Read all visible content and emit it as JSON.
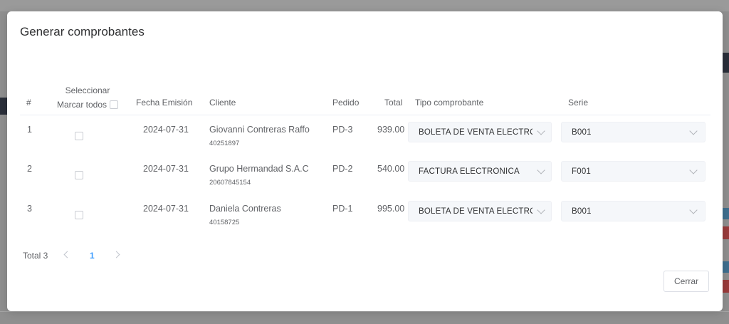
{
  "dialog": {
    "title": "Generar comprobantes"
  },
  "table": {
    "headers": {
      "index": "#",
      "select_line1": "Seleccionar",
      "select_line2": "Marcar todos",
      "fecha": "Fecha Emisión",
      "cliente": "Cliente",
      "pedido": "Pedido",
      "total": "Total",
      "tipo": "Tipo comprobante",
      "serie": "Serie"
    },
    "rows": [
      {
        "index": "1",
        "fecha": "2024-07-31",
        "cliente": "Giovanni Contreras Raffo",
        "doc": "40251897",
        "pedido": "PD-3",
        "total": "939.00",
        "tipo": "BOLETA DE VENTA ELECTRÓNICA",
        "serie": "B001"
      },
      {
        "index": "2",
        "fecha": "2024-07-31",
        "cliente": "Grupo Hermandad S.A.C",
        "doc": "20607845154",
        "pedido": "PD-2",
        "total": "540.00",
        "tipo": "FACTURA ELECTRÓNICA",
        "serie": "F001"
      },
      {
        "index": "3",
        "fecha": "2024-07-31",
        "cliente": "Daniela Contreras",
        "doc": "40158725",
        "pedido": "PD-1",
        "total": "995.00",
        "tipo": "BOLETA DE VENTA ELECTRÓNICA",
        "serie": "B001"
      }
    ]
  },
  "pagination": {
    "total_label": "Total 3",
    "current_page": "1"
  },
  "footer": {
    "close_label": "Cerrar"
  },
  "colors": {
    "accent": "#409eff",
    "overlay": "#8f8f8f"
  }
}
